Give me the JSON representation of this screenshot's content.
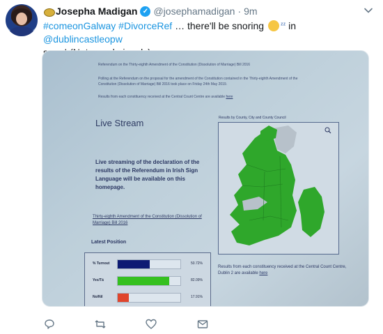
{
  "author": {
    "name": "Josepha Madigan",
    "handle": "@josephamadigan",
    "separator": "·",
    "time": "9m"
  },
  "tweet": {
    "hashtag1": "#comeonGalway",
    "hashtag2": "#DivorceRef",
    "mid_text": " … there'll be snoring ",
    "zz": "ᶻᶻ",
    "in_text": " in ",
    "mention": "@dublincastleopw",
    "end_text": "soon! (Not me obviously)"
  },
  "photo": {
    "heading_small": "Referendum on the Thirty-eighth Amendment of the Constitution (Dissolution of Marriage) Bill 2016",
    "polling_line1": "Polling at the Referendum on the proposal for the amendment of the Constitution contained in the Thirty-eighth Amendment of the",
    "polling_line2": "Constitution (Dissolution of Marriage) Bill 2016 took place on Friday 24th May 2019.",
    "results_line": "Results from each constituency received at the Central Count Centre are available",
    "results_link": "here",
    "live_title": "Live Stream",
    "live_body": "Live streaming of the declaration of the results of the Referendum in Irish Sign Language will be available on this homepage.",
    "amend_link": "Thirty-eighth Amendment of the Constitution (Dissolution of Marriage) Bill 2016",
    "latest_position": "Latest Position",
    "rows": [
      {
        "label": "% Turnout",
        "value": "50.72%",
        "fraction": 0.51,
        "color": "#0d1a73"
      },
      {
        "label": "Yes/Tá",
        "value": "82.09%",
        "fraction": 0.82,
        "color": "#35c01f"
      },
      {
        "label": "No/Níl",
        "value": "17.91%",
        "fraction": 0.18,
        "color": "#e0452c"
      }
    ],
    "map_label": "Results by County, City and County Council",
    "map_note": "Results from each constituency received at the Central Count Centre, Dublin 2 are available",
    "map_note_link": "here"
  },
  "colors": {
    "link": "#1b95e0",
    "map_green": "#2fa72b",
    "map_grey": "#b7c1ca"
  }
}
